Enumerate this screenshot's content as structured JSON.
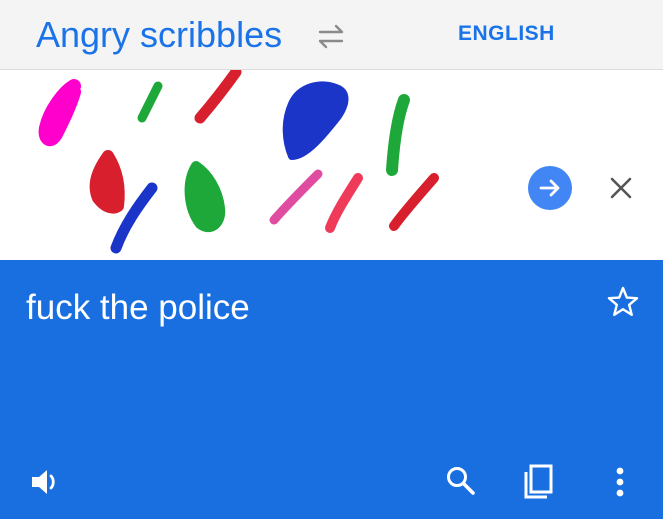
{
  "header": {
    "source_language": "Angry scribbles",
    "target_language": "ENGLISH",
    "swap_icon": "swap-arrows-icon"
  },
  "input": {
    "content": "handwritten colored scribbles",
    "go_icon": "arrow-right-icon",
    "clear_icon": "close-icon",
    "speak_icon": "speaker-icon"
  },
  "result": {
    "translation": "fuck the police",
    "star_icon": "star-outline-icon",
    "speak_icon": "speaker-icon",
    "search_icon": "search-icon",
    "copy_icon": "copy-icon",
    "more_icon": "more-vert-icon"
  },
  "colors": {
    "accent": "#1a73e8",
    "result_background": "#1a6fe0",
    "go_button": "#4285f4",
    "scribble_colors": [
      "#ff00cc",
      "#1fa83a",
      "#d81f2e",
      "#1b35c8",
      "#e04da0",
      "#f03a5a"
    ]
  }
}
